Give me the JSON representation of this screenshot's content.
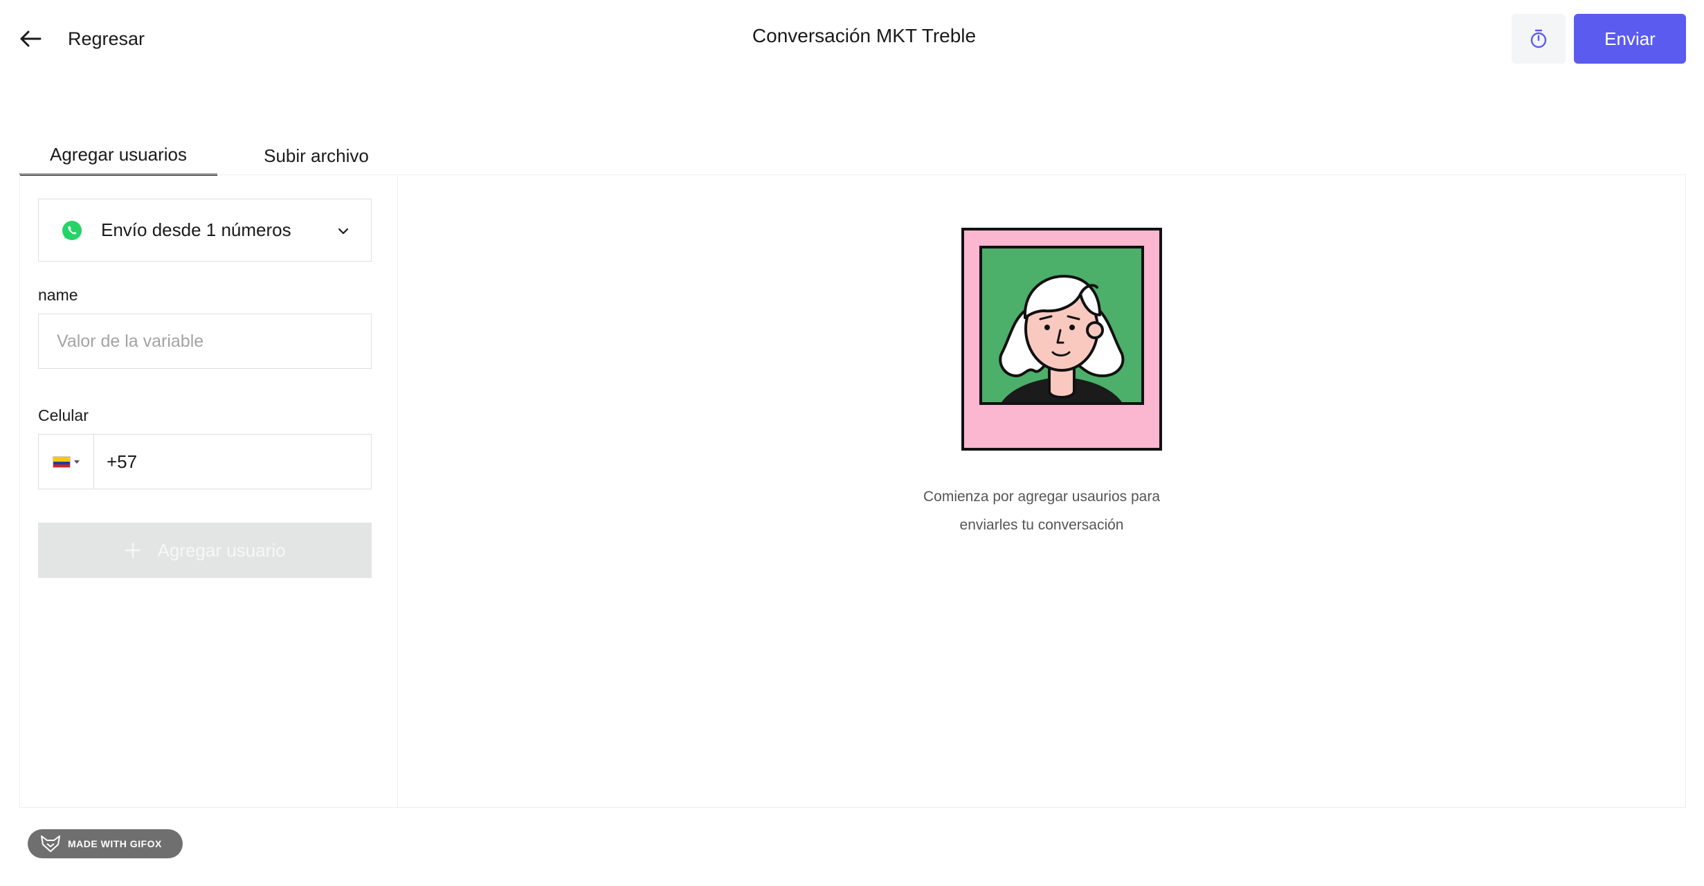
{
  "header": {
    "back_label": "Regresar",
    "title": "Conversación MKT Treble",
    "timer_icon": "stopwatch-icon",
    "send_label": "Enviar"
  },
  "tabs": [
    {
      "label": "Agregar usuarios",
      "active": true
    },
    {
      "label": "Subir archivo",
      "active": false
    }
  ],
  "form": {
    "sender": {
      "icon": "whatsapp-icon",
      "label": "Envío desde 1 números"
    },
    "name_field": {
      "label": "name",
      "value": "",
      "placeholder": "Valor de la variable"
    },
    "phone_field": {
      "label": "Celular",
      "country": "colombia-flag",
      "value": "+57"
    },
    "add_user_label": "Agregar usuario"
  },
  "empty_state": {
    "line1": "Comienza por agregar usaurios para",
    "line2": "enviarles tu conversación"
  },
  "watermark": {
    "label": "MADE WITH GIFOX"
  },
  "colors": {
    "accent": "#5b5bf0",
    "whatsapp": "#25d366",
    "illustration_pink": "#fbb6d0",
    "illustration_green": "#4caf6a",
    "disabled_bg": "#e3e4e4"
  }
}
